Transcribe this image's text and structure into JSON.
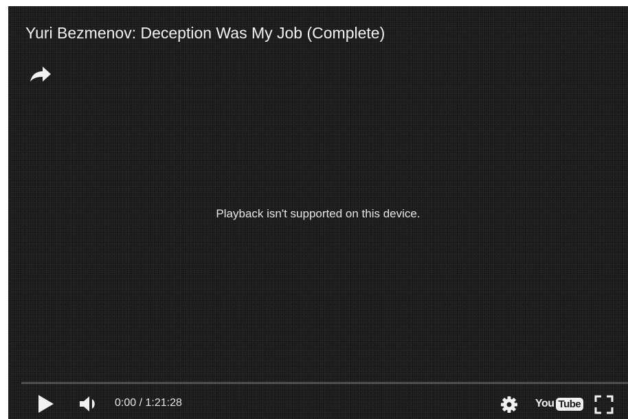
{
  "video": {
    "title": "Yuri Bezmenov: Deception Was My Job (Complete)",
    "message": "Playback isn't supported on this device."
  },
  "icons": {
    "share": "share-arrow-icon",
    "play": "play-icon",
    "volume": "volume-icon",
    "settings": "gear-icon",
    "logo": "youtube-logo",
    "fullscreen": "fullscreen-icon"
  },
  "controls": {
    "time_display": "0:00 / 1:21:28",
    "progress_fraction": 0
  },
  "logo": {
    "you": "You",
    "tube": "Tube"
  },
  "colors": {
    "background": "#1b1b1b",
    "text": "#f1f1f1",
    "progress_played": "#cc181e"
  }
}
